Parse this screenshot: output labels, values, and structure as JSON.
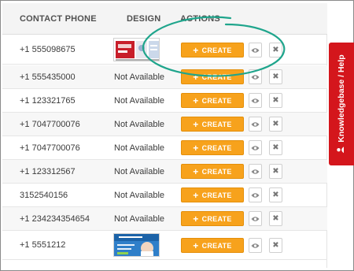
{
  "table": {
    "headers": {
      "phone": "CONTACT PHONE",
      "design": "DESIGN",
      "actions": "ACTIONS"
    },
    "rows": [
      {
        "phone": "+1 555098675",
        "design": "",
        "design_is_image": true
      },
      {
        "phone": "+1 555435000",
        "design": "Not Available",
        "design_is_image": false
      },
      {
        "phone": "+1 123321765",
        "design": "Not Available",
        "design_is_image": false
      },
      {
        "phone": "+1 7047700076",
        "design": "Not Available",
        "design_is_image": false
      },
      {
        "phone": "+1 7047700076",
        "design": "Not Available",
        "design_is_image": false
      },
      {
        "phone": "+1 123312567",
        "design": "Not Available",
        "design_is_image": false
      },
      {
        "phone": "3152540156",
        "design": "Not Available",
        "design_is_image": false
      },
      {
        "phone": "+1 234234354654",
        "design": "Not Available",
        "design_is_image": false
      },
      {
        "phone": "+1 5551212",
        "design": "",
        "design_is_image": true
      }
    ],
    "create_label": "CREATE",
    "view_icon": "eye-icon",
    "delete_icon": "close-icon"
  },
  "knowledgebase": {
    "label": "Knowledgebase / Help",
    "icon": "person-icon"
  },
  "colors": {
    "accent_orange": "#f7a21c",
    "help_red": "#d4161c",
    "annotation_teal": "#1fa58c"
  }
}
